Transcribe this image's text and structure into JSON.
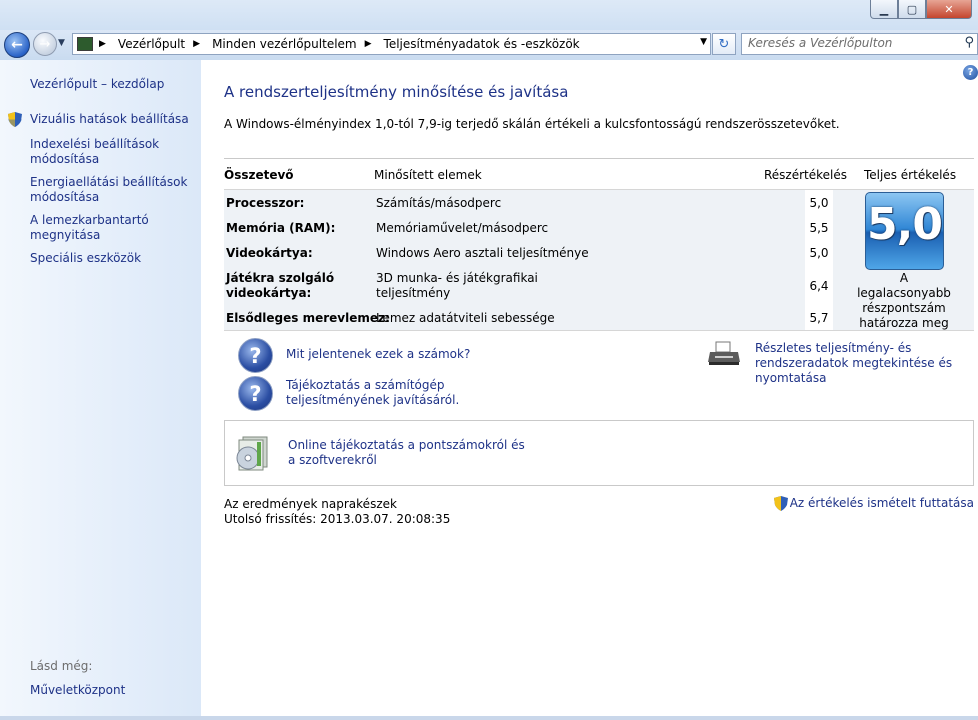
{
  "window": {
    "minimize_glyph": "▁",
    "maximize_glyph": "▢",
    "close_glyph": "✕"
  },
  "nav": {
    "back_glyph": "←",
    "forward_glyph": "→",
    "recent_glyph": "▼",
    "breadcrumbs": [
      "Vezérlőpult",
      "Minden vezérlőpultelem",
      "Teljesítményadatok és -eszközök"
    ],
    "crumb_separator": "▶",
    "address_dropdown_glyph": "▼",
    "refresh_glyph": "↻",
    "search_placeholder": "Keresés a Vezérlőpulton",
    "search_glyph": "⚲"
  },
  "sidebar": {
    "items": [
      {
        "label": "Vezérlőpult – kezdőlap"
      },
      {
        "label": "Vizuális hatások beállítása"
      },
      {
        "label": "Indexelési beállítások módosítása"
      },
      {
        "label": "Energiaellátási beállítások módosítása"
      },
      {
        "label": "A lemezkarbantartó megnyitása"
      },
      {
        "label": "Speciális eszközök"
      }
    ],
    "see_also_label": "Lásd még:",
    "see_also_items": [
      {
        "label": "Műveletközpont"
      }
    ]
  },
  "main": {
    "help_glyph": "?",
    "title": "A rendszerteljesítmény minősítése és javítása",
    "intro": "A Windows-élményindex 1,0-tól 7,9-ig terjedő skálán értékeli a kulcsfontosságú rendszerösszetevőket.",
    "table": {
      "headers": {
        "component": "Összetevő",
        "rated": "Minősített elemek",
        "subscore": "Részértékelés",
        "base": "Teljes értékelés"
      },
      "rows": [
        {
          "component": "Processzor:",
          "item": "Számítás/másodperc",
          "score": "5,0"
        },
        {
          "component": "Memória (RAM):",
          "item": "Memóriaművelet/másodperc",
          "score": "5,5"
        },
        {
          "component": "Videokártya:",
          "item": "Windows Aero asztali teljesítménye",
          "score": "5,0"
        },
        {
          "component": "Játékra szolgáló\nvideokártya:",
          "item": "3D munka- és játékgrafikai\nteljesítmény",
          "score": "6,4"
        },
        {
          "component": "Elsődleges merevlemez:",
          "item": "Lemez adatátviteli sebessége",
          "score": "5,7"
        }
      ],
      "base_score": "5,0",
      "base_note": "A legalacsonyabb részpontszám határozza meg"
    },
    "links": {
      "question_glyph": "?",
      "what_numbers": "Mit jelentenek ezek a számok?",
      "tips": "Tájékoztatás a számítógép teljesítményének javításáról.",
      "details": "Részletes teljesítmény- és rendszeradatok megtekintése és nyomtatása",
      "online": "Online tájékoztatás a pontszámokról és a szoftverekről"
    },
    "status": "Az eredmények naprakészek",
    "last_update": "Utolsó frissítés: 2013.03.07. 20:08:35",
    "rerun": "Az értékelés ismételt futtatása"
  },
  "colors": {
    "link": "#1e3287",
    "sidebar_top": "#f2f7fd",
    "sidebar_bottom": "#dbe8f8",
    "badge": "#2f86d5"
  }
}
